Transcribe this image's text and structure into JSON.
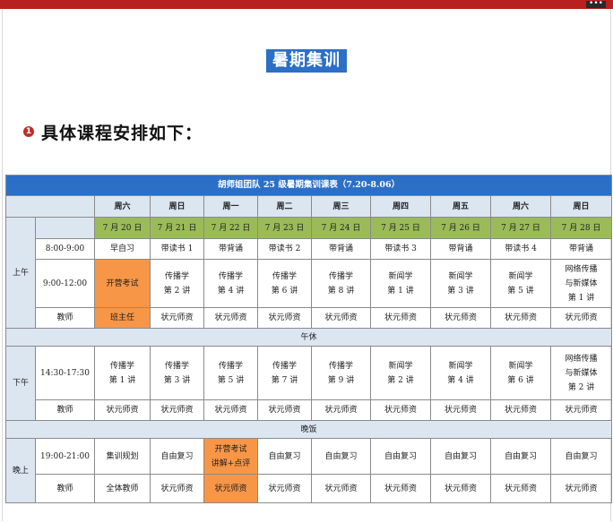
{
  "window": {
    "more_glyph": "•••"
  },
  "title": "暑期集训",
  "section": {
    "number": "1",
    "heading": "具体课程安排如下："
  },
  "table": {
    "caption": "胡师姐团队 25 级暑期集训课表（7.20-8.06）",
    "weekdays": [
      "周六",
      "周日",
      "周一",
      "周二",
      "周三",
      "周四",
      "周五",
      "周六",
      "周日"
    ],
    "dates": [
      "7 月 20 日",
      "7 月 21 日",
      "7 月 22 日",
      "7 月 23 日",
      "7 月 24 日",
      "7 月 25 日",
      "7 月 26 日",
      "7 月 27 日",
      "7 月 28 日"
    ],
    "sections": {
      "morning": "上午",
      "afternoon": "下午",
      "evening": "晚上"
    },
    "breaks": {
      "noon": "午休",
      "dinner": "晚饭"
    },
    "morning": {
      "slot1_time": "8:00-9:00",
      "slot1": [
        "早自习",
        "带读书 1",
        "带背诵",
        "带读书 2",
        "带背诵",
        "带读书 3",
        "带背诵",
        "带读书 4",
        "带背诵"
      ],
      "slot2_time": "9:00-12:00",
      "slot2": [
        [
          "开营考试"
        ],
        [
          "传播学",
          "第 2 讲"
        ],
        [
          "传播学",
          "第 4 讲"
        ],
        [
          "传播学",
          "第 6 讲"
        ],
        [
          "传播学",
          "第 8 讲"
        ],
        [
          "新闻学",
          "第 1 讲"
        ],
        [
          "新闻学",
          "第 3 讲"
        ],
        [
          "新闻学",
          "第 5 讲"
        ],
        [
          "网络传播",
          "与新媒体",
          "第 1 讲"
        ]
      ],
      "teacher_label": "教师",
      "teachers": [
        "班主任",
        "状元师资",
        "状元师资",
        "状元师资",
        "状元师资",
        "状元师资",
        "状元师资",
        "状元师资",
        "状元师资"
      ]
    },
    "afternoon": {
      "time": "14:30-17:30",
      "slot": [
        [
          "传播学",
          "第 1 讲"
        ],
        [
          "传播学",
          "第 3 讲"
        ],
        [
          "传播学",
          "第 5 讲"
        ],
        [
          "传播学",
          "第 7 讲"
        ],
        [
          "传播学",
          "第 9 讲"
        ],
        [
          "新闻学",
          "第 2 讲"
        ],
        [
          "新闻学",
          "第 4 讲"
        ],
        [
          "新闻学",
          "第 6 讲"
        ],
        [
          "网络传播",
          "与新媒体",
          "第 2 讲"
        ]
      ],
      "teacher_label": "教师",
      "teachers": [
        "状元师资",
        "状元师资",
        "状元师资",
        "状元师资",
        "状元师资",
        "状元师资",
        "状元师资",
        "状元师资",
        "状元师资"
      ]
    },
    "evening": {
      "time": "19:00-21:00",
      "slot": [
        [
          "集训规划"
        ],
        [
          "自由复习"
        ],
        [
          "开营考试",
          "讲解+点评"
        ],
        [
          "自由复习"
        ],
        [
          "自由复习"
        ],
        [
          "自由复习"
        ],
        [
          "自由复习"
        ],
        [
          "自由复习"
        ],
        [
          "自由复习"
        ]
      ],
      "teacher_label": "教师",
      "teachers": [
        "全体教师",
        "状元师资",
        "状元师资",
        "状元师资",
        "状元师资",
        "状元师资",
        "状元师资",
        "状元师资",
        "状元师资"
      ]
    },
    "colors": {
      "header_blue": "#2c6fc7",
      "light_blue": "#dce6f1",
      "date_green": "#9bbb59",
      "highlight_orange": "#f79646"
    }
  }
}
